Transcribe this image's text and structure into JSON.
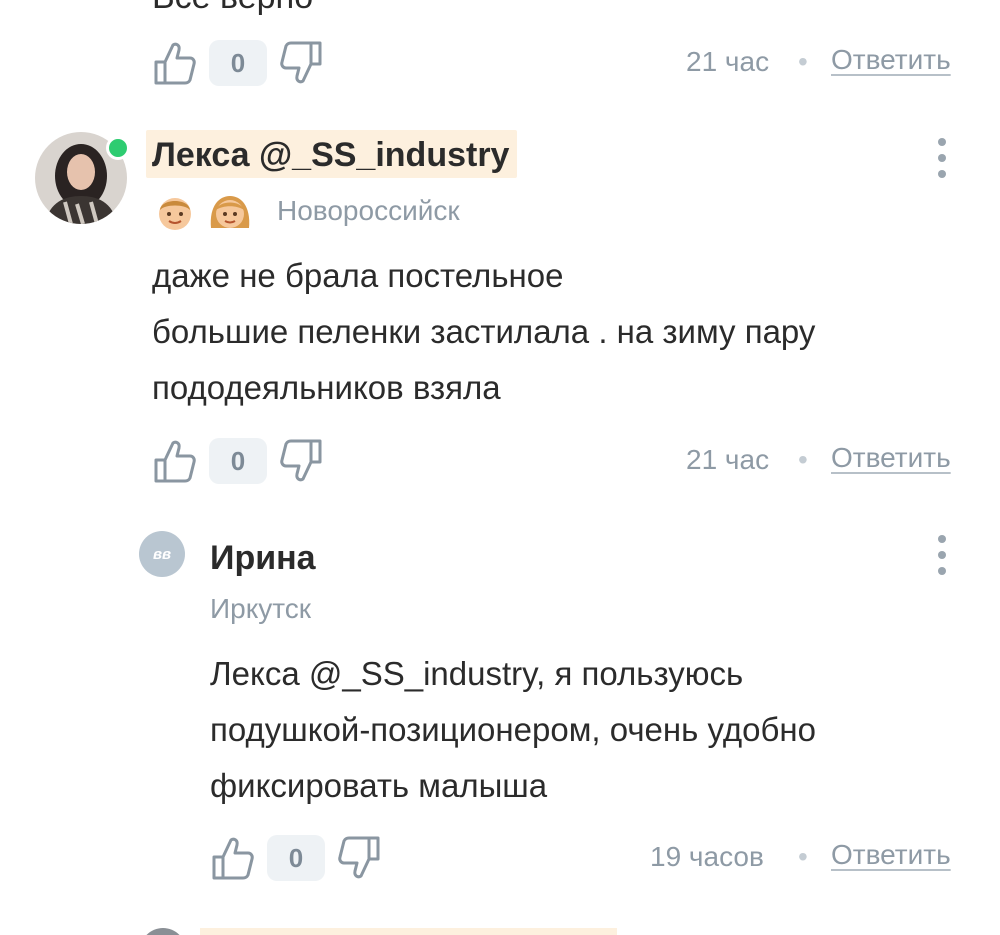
{
  "prev_comment": {
    "text_clipped": "Все верно",
    "likes": "0",
    "time": "21 час",
    "reply_label": "Ответить"
  },
  "comment1": {
    "author": "Лекса @_SS_industry",
    "city": "Новороссийск",
    "badges": [
      "boy-emoji-icon",
      "girl-emoji-icon"
    ],
    "online": true,
    "body_lines": [
      "даже не брала постельное",
      "большие пеленки застилала . на зиму пару",
      "пододеяльников взяла"
    ],
    "likes": "0",
    "time": "21 час",
    "reply_label": "Ответить"
  },
  "reply1": {
    "author": "Ирина",
    "avatar_text": "вв",
    "city": "Иркутск",
    "mention": "Лекса @_SS_industry",
    "body_rest_line1": ", я пользуюсь",
    "body_line2": "подушкой-позиционером, очень удобно",
    "body_line3": "фиксировать малыша",
    "likes": "0",
    "time": "19 часов",
    "reply_label": "Ответить"
  },
  "colors": {
    "highlight": "#fdf0de",
    "muted_text": "#8e9aa5",
    "online": "#2ecc71",
    "badge_bg": "#eef2f5"
  }
}
